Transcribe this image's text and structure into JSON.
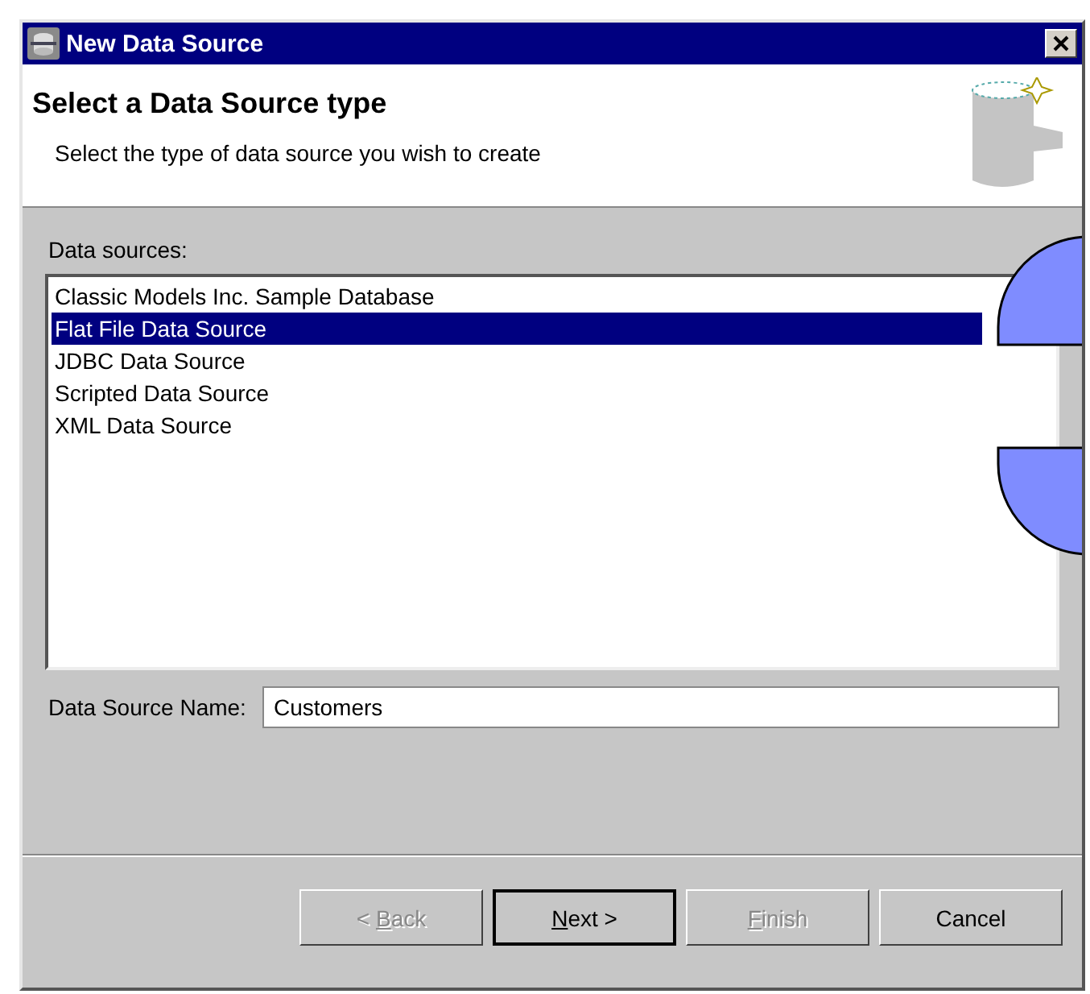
{
  "window": {
    "title": "New Data Source"
  },
  "header": {
    "title": "Select a Data Source type",
    "description": "Select the type of data source you wish to create"
  },
  "data_sources": {
    "label": "Data sources:",
    "items": [
      {
        "label": "Classic Models Inc. Sample Database",
        "selected": false
      },
      {
        "label": "Flat File Data Source",
        "selected": true
      },
      {
        "label": "JDBC Data Source",
        "selected": false
      },
      {
        "label": "Scripted Data Source",
        "selected": false
      },
      {
        "label": "XML Data Source",
        "selected": false
      }
    ]
  },
  "name_field": {
    "label": "Data Source Name:",
    "value": "Customers"
  },
  "buttons": [
    {
      "before": "< ",
      "mnemonic": "B",
      "after": "ack",
      "disabled": true,
      "default": false
    },
    {
      "mnemonic": "N",
      "after": "ext >",
      "disabled": false,
      "default": true
    },
    {
      "mnemonic": "F",
      "after": "inish",
      "disabled": true,
      "default": false
    },
    {
      "before": "Cancel",
      "disabled": false,
      "default": false
    }
  ]
}
